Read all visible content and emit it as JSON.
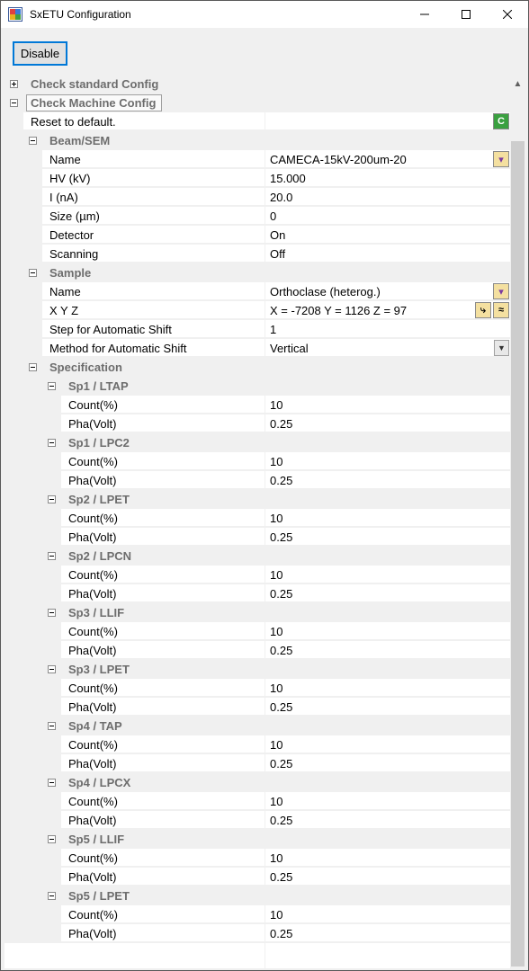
{
  "window": {
    "title": "SxETU Configuration"
  },
  "toolbar": {
    "disable_label": "Disable"
  },
  "grid": {
    "standard_config": "Check standard Config",
    "machine_config": "Check Machine Config",
    "reset_label": "Reset to default.",
    "beam": {
      "title": "Beam/SEM",
      "props": [
        {
          "name": "Name",
          "value": "CAMECA-15kV-200um-20"
        },
        {
          "name": "HV (kV)",
          "value": "15.000"
        },
        {
          "name": "I (nA)",
          "value": "20.0"
        },
        {
          "name": "Size (µm)",
          "value": "0"
        },
        {
          "name": "Detector",
          "value": "On"
        },
        {
          "name": "Scanning",
          "value": "Off"
        }
      ]
    },
    "sample": {
      "title": "Sample",
      "props": [
        {
          "name": "Name",
          "value": "Orthoclase (heterog.)"
        },
        {
          "name": "X Y Z",
          "value": " X = -7208 Y = 1126 Z = 97"
        },
        {
          "name": "Step for Automatic Shift",
          "value": "1"
        },
        {
          "name": "Method for Automatic Shift",
          "value": "Vertical"
        }
      ]
    },
    "spec": {
      "title": "Specification",
      "groups": [
        {
          "title": "Sp1 / LTAP",
          "count_label": "Count(%)",
          "count": "10",
          "pha_label": "Pha(Volt)",
          "pha": "0.25"
        },
        {
          "title": "Sp1 / LPC2",
          "count_label": "Count(%)",
          "count": "10",
          "pha_label": "Pha(Volt)",
          "pha": "0.25"
        },
        {
          "title": "Sp2 / LPET",
          "count_label": "Count(%)",
          "count": "10",
          "pha_label": "Pha(Volt)",
          "pha": "0.25"
        },
        {
          "title": "Sp2 / LPCN",
          "count_label": "Count(%)",
          "count": "10",
          "pha_label": "Pha(Volt)",
          "pha": "0.25"
        },
        {
          "title": "Sp3 / LLIF",
          "count_label": "Count(%)",
          "count": "10",
          "pha_label": "Pha(Volt)",
          "pha": "0.25"
        },
        {
          "title": "Sp3 / LPET",
          "count_label": "Count(%)",
          "count": "10",
          "pha_label": "Pha(Volt)",
          "pha": "0.25"
        },
        {
          "title": "Sp4 / TAP",
          "count_label": "Count(%)",
          "count": "10",
          "pha_label": "Pha(Volt)",
          "pha": "0.25"
        },
        {
          "title": "Sp4 / LPCX",
          "count_label": "Count(%)",
          "count": "10",
          "pha_label": "Pha(Volt)",
          "pha": "0.25"
        },
        {
          "title": "Sp5 / LLIF",
          "count_label": "Count(%)",
          "count": "10",
          "pha_label": "Pha(Volt)",
          "pha": "0.25"
        },
        {
          "title": "Sp5 / LPET",
          "count_label": "Count(%)",
          "count": "10",
          "pha_label": "Pha(Volt)",
          "pha": "0.25"
        }
      ]
    }
  }
}
